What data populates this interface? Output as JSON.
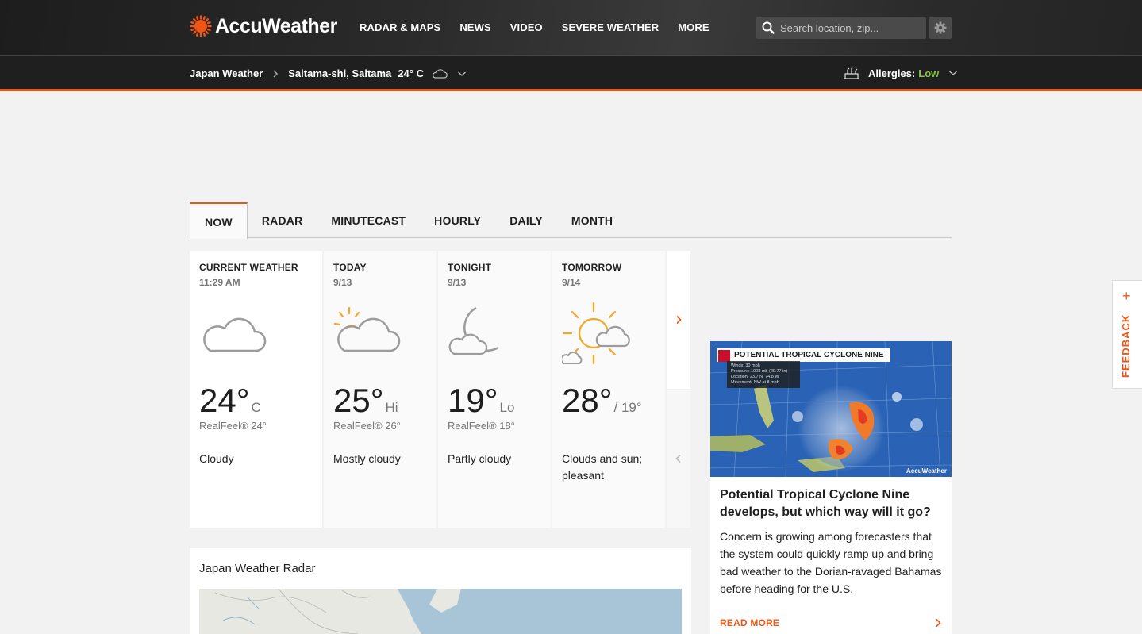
{
  "header": {
    "logo_text": "AccuWeather",
    "nav": [
      "RADAR & MAPS",
      "NEWS",
      "VIDEO",
      "SEVERE WEATHER",
      "MORE"
    ],
    "search_placeholder": "Search location, zip..."
  },
  "subheader": {
    "country": "Japan Weather",
    "city": "Saitama-shi, Saitama",
    "temp": "24° C",
    "allergies_label": "Allergies:",
    "allergies_value": "Low"
  },
  "tabs": [
    "NOW",
    "RADAR",
    "MINUTECAST",
    "HOURLY",
    "DAILY",
    "MONTH"
  ],
  "cards": [
    {
      "title": "CURRENT WEATHER",
      "date": "11:29 AM",
      "temp": "24°",
      "suffix": "C",
      "realfeel": "RealFeel® 24°",
      "phrase": "Cloudy",
      "icon": "cloudy-icon"
    },
    {
      "title": "TODAY",
      "date": "9/13",
      "temp": "25°",
      "suffix": "Hi",
      "realfeel": "RealFeel® 26°",
      "phrase": "Mostly cloudy",
      "icon": "mostly-cloudy-icon"
    },
    {
      "title": "TONIGHT",
      "date": "9/13",
      "temp": "19°",
      "suffix": "Lo",
      "realfeel": "RealFeel® 18°",
      "phrase": "Partly cloudy",
      "icon": "partly-cloudy-night-icon"
    },
    {
      "title": "TOMORROW",
      "date": "9/14",
      "temp": "28°",
      "suffix": "/ 19°",
      "realfeel": "",
      "phrase": "Clouds and sun; pleasant",
      "icon": "clouds-and-sun-icon"
    }
  ],
  "radar": {
    "title": "Japan Weather Radar"
  },
  "article": {
    "image_label": "POTENTIAL TROPICAL CYCLONE NINE",
    "image_stats": [
      "Winds: 30 mph",
      "Pressure: 1008 mb (29.77 in)",
      "Location: 23.7 N, 74.8 W",
      "Movement: NW at 8 mph"
    ],
    "image_brand": "AccuWeather",
    "headline": "Potential Tropical Cyclone Nine develops, but which way will it go?",
    "summary": "Concern is growing among forecasters that the system could quickly ramp up and bring bad weather to the Dorian-ravaged Bahamas before heading for the U.S.",
    "read_more": "READ MORE"
  },
  "feedback": {
    "label": "FEEDBACK",
    "plus": "+"
  },
  "colors": {
    "accent": "#f05514",
    "allergy_low": "#8cc63f",
    "header_bg": "#1f1f1f"
  }
}
